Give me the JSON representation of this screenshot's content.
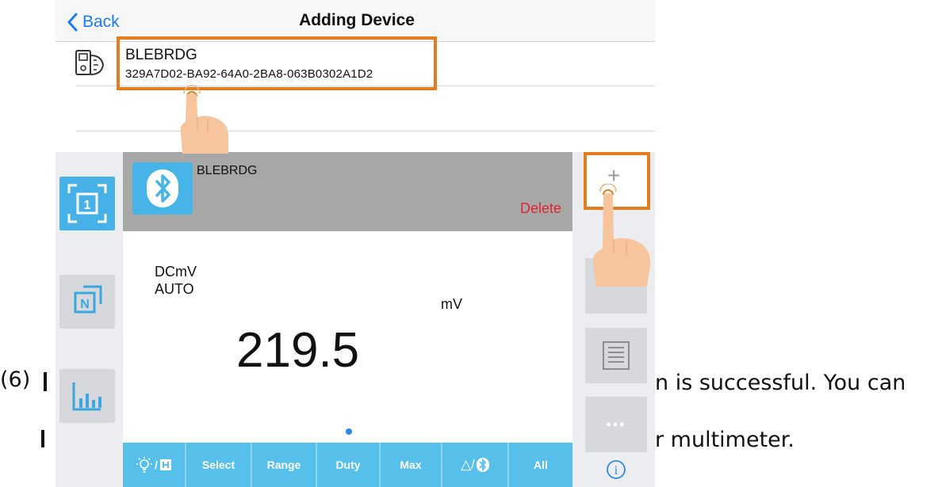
{
  "adding_device": {
    "back_label": "Back",
    "title": "Adding Device",
    "device": {
      "name": "BLEBRDG",
      "uuid": "329A7D02-BA92-64A0-2BA8-063B0302A1D2"
    }
  },
  "meter": {
    "card": {
      "name": "BLEBRDG",
      "delete_label": "Delete"
    },
    "mode_line_1": "DCmV",
    "mode_line_2": "AUTO",
    "unit": "mV",
    "value": "219.5",
    "left_rail": [
      {
        "label": "1",
        "icon": "single-view-icon"
      },
      {
        "label": "N",
        "icon": "multi-view-icon"
      },
      {
        "label": "",
        "icon": "bar-chart-icon"
      }
    ],
    "right_rail": {
      "add_label": "+",
      "more_label": "•••",
      "info_label": "i"
    },
    "bottom_bar": [
      {
        "label": "/",
        "icon": "backlight-hold-icon"
      },
      {
        "label": "Select"
      },
      {
        "label": "Range"
      },
      {
        "label": "Duty"
      },
      {
        "label": "Max"
      },
      {
        "label": "△/",
        "icon": "bluetooth-icon"
      },
      {
        "label": "All"
      }
    ]
  },
  "manual_text": {
    "step": "(6)",
    "fragment_1": "n is successful. You can",
    "fragment_2": "r multimeter."
  },
  "colors": {
    "highlight": "#e57c1d",
    "accent_blue": "#47b4e8",
    "delete_red": "#e02432",
    "ios_blue": "#1a7cf5"
  }
}
